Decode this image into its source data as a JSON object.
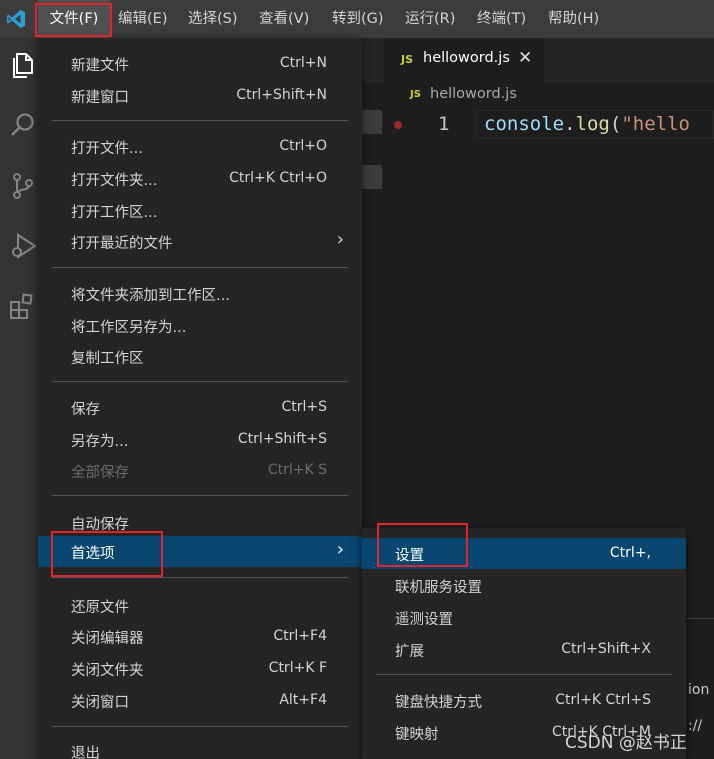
{
  "menubar": {
    "items": [
      {
        "label": "文件(F)",
        "left": 0
      },
      {
        "label": "编辑(E)"
      },
      {
        "label": "选择(S)"
      },
      {
        "label": "查看(V)"
      },
      {
        "label": "转到(G)"
      },
      {
        "label": "运行(R)"
      },
      {
        "label": "终端(T)"
      },
      {
        "label": "帮助(H)"
      }
    ]
  },
  "file_menu": {
    "items": [
      {
        "label": "新建文件",
        "shortcut": "Ctrl+N"
      },
      {
        "label": "新建窗口",
        "shortcut": "Ctrl+Shift+N"
      },
      {
        "label": "打开文件...",
        "shortcut": "Ctrl+O"
      },
      {
        "label": "打开文件夹...",
        "shortcut": "Ctrl+K Ctrl+O"
      },
      {
        "label": "打开工作区...",
        "shortcut": ""
      },
      {
        "label": "打开最近的文件",
        "shortcut": ""
      },
      {
        "label": "将文件夹添加到工作区...",
        "shortcut": ""
      },
      {
        "label": "将工作区另存为...",
        "shortcut": ""
      },
      {
        "label": "复制工作区",
        "shortcut": ""
      },
      {
        "label": "保存",
        "shortcut": "Ctrl+S"
      },
      {
        "label": "另存为...",
        "shortcut": "Ctrl+Shift+S"
      },
      {
        "label": "全部保存",
        "shortcut": "Ctrl+K S"
      },
      {
        "label": "自动保存",
        "shortcut": ""
      },
      {
        "label": "首选项",
        "shortcut": ""
      },
      {
        "label": "还原文件",
        "shortcut": ""
      },
      {
        "label": "关闭编辑器",
        "shortcut": "Ctrl+F4"
      },
      {
        "label": "关闭文件夹",
        "shortcut": "Ctrl+K F"
      },
      {
        "label": "关闭窗口",
        "shortcut": "Alt+F4"
      },
      {
        "label": "退出",
        "shortcut": ""
      }
    ]
  },
  "sub_menu": {
    "items": [
      {
        "label": "设置",
        "shortcut": "Ctrl+,"
      },
      {
        "label": "联机服务设置",
        "shortcut": ""
      },
      {
        "label": "遥测设置",
        "shortcut": ""
      },
      {
        "label": "扩展",
        "shortcut": "Ctrl+Shift+X"
      },
      {
        "label": "键盘快捷方式",
        "shortcut": "Ctrl+K Ctrl+S"
      },
      {
        "label": "键映射",
        "shortcut": "Ctrl+K Ctrl+M"
      }
    ]
  },
  "editor": {
    "tab_label": "helloword.js",
    "tab_badge": "JS",
    "breadcrumb_label": "helloword.js",
    "breadcrumb_badge": "JS",
    "line_number": "1",
    "code": {
      "obj": "console",
      "dot": ".",
      "fn": "log",
      "paren": "(",
      "str": "\"hello"
    }
  },
  "panel": {
    "text_1": "ion",
    "text_2": "://"
  },
  "watermark": "CSDN @赵书正",
  "colors": {
    "menu_selected": "#094771",
    "highlight_box": "#e2242d",
    "js_badge": "#cbcb41"
  },
  "icons": {
    "app": "vscode-logo-icon",
    "explorer": "files-icon",
    "search": "search-icon",
    "scm": "source-control-icon",
    "debug": "run-debug-icon",
    "extensions": "extensions-icon",
    "close": "close-icon",
    "submenu": "chevron-right-icon"
  }
}
